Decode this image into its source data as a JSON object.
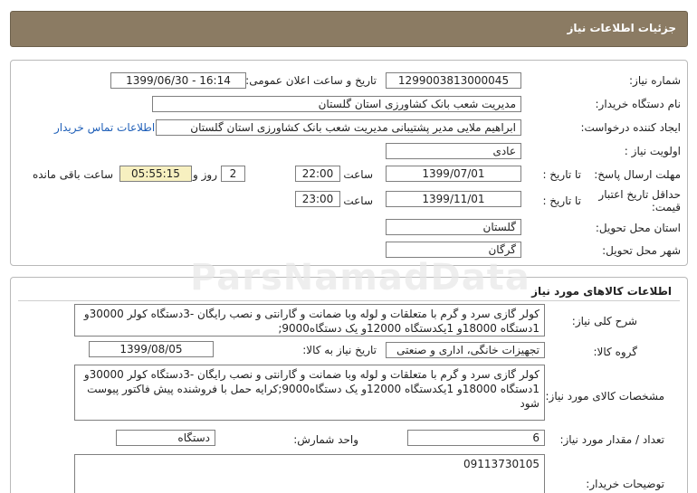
{
  "header": {
    "title": "جزئیات اطلاعات نیاز"
  },
  "info": {
    "need_number_label": "شماره نیاز:",
    "need_number": "1299003813000045",
    "announce_label": "تاریخ و ساعت اعلان عمومی:",
    "announce_value": "1399/06/30 - 16:14",
    "buyer_org_label": "نام دستگاه خریدار:",
    "buyer_org": "مدیریت شعب بانک کشاورزی استان گلستان",
    "requester_label": "ایجاد کننده درخواست:",
    "requester": "ابراهیم ملایی  مدیر پشتیبانی مدیریت شعب بانک کشاورزی استان گلستان",
    "contact_link": "اطلاعات تماس خریدار",
    "priority_label": "اولویت نیاز :",
    "priority": "عادی",
    "deadline_label": "مهلت ارسال پاسخ:",
    "to_date_label": "تا تاریخ :",
    "deadline_date": "1399/07/01",
    "time_label": "ساعت",
    "deadline_time": "22:00",
    "days_value": "2",
    "days_label": "روز و",
    "remaining_time": "05:55:15",
    "remaining_label": "ساعت باقی مانده",
    "validity_label": "حداقل تاریخ اعتبار قیمت:",
    "validity_to_date_label": "تا تاریخ :",
    "validity_date": "1399/11/01",
    "validity_time_label": "ساعت",
    "validity_time": "23:00",
    "province_label": "استان محل تحویل:",
    "province": "گلستان",
    "city_label": "شهر محل تحویل:",
    "city": "گرگان"
  },
  "goods": {
    "title": "اطلاعات کالاهای مورد نیاز",
    "summary_label": "شرح کلی نیاز:",
    "summary": "کولر گازی سرد و گرم با متعلقات و لوله وبا ضمانت و گارانتی و نصب رایگان -3دستگاه کولر 30000و 1دستگاه 18000و 1یکدستگاه 12000و یک دستگاه9000;",
    "group_label": "گروه کالا:",
    "group": "تجهیزات خانگی، اداری و صنعتی",
    "need_date_label": "تاریخ نیاز به کالا:",
    "need_date": "1399/08/05",
    "spec_label": "مشخصات کالای مورد نیاز:",
    "spec": "کولر گازی سرد و گرم با متعلقات و لوله وبا ضمانت و گارانتی و نصب رایگان -3دستگاه کولر 30000و 1دستگاه 18000و 1یکدستگاه 12000و یک دستگاه9000;کرایه حمل با فروشنده پیش فاکتور پیوست شود",
    "quantity_label": "تعداد / مقدار مورد نیاز:",
    "quantity": "6",
    "unit_label": "واحد شمارش:",
    "unit": "دستگاه",
    "buyer_notes_label": "توضیحات خریدار:",
    "buyer_notes": "09113730105"
  },
  "watermark": {
    "text": "ParsNamadData"
  }
}
